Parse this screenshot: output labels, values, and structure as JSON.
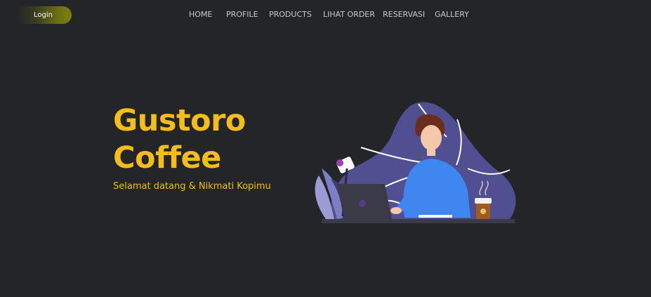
{
  "header": {
    "login_label": "Login"
  },
  "nav": {
    "items": [
      {
        "label": "HOME"
      },
      {
        "label": "PROFILE"
      },
      {
        "label": "PRODUCTS"
      },
      {
        "label": "LIHAT ORDER"
      },
      {
        "label": "RESERVASI"
      },
      {
        "label": "GALLERY"
      }
    ]
  },
  "hero": {
    "title_line1": "Gustoro",
    "title_line2": "Coffee",
    "subtitle": "Selamat datang & Nikmati Kopimu",
    "illustration_icon": "person-working-on-laptop-with-coffee"
  },
  "colors": {
    "background": "#232529",
    "accent": "#f5bd1a",
    "nav_text": "#c9c9c9",
    "blob": "#4f4f92"
  }
}
